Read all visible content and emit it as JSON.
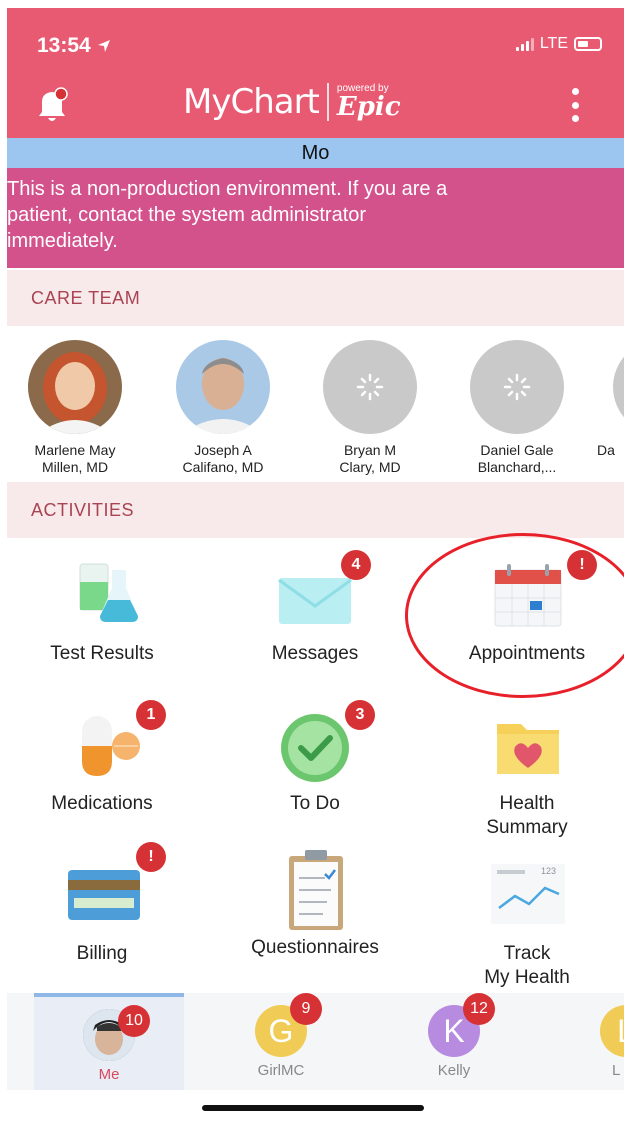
{
  "status_bar": {
    "time": "13:54",
    "network": "LTE"
  },
  "header": {
    "logo_text": "MyChart",
    "powered_by": "powered by",
    "epic": "Epic"
  },
  "patient_bar": {
    "name": "Mo"
  },
  "warning": {
    "lines": [
      "This is a non-production environment. If you are a",
      "patient, contact the system administrator",
      "immediately."
    ]
  },
  "care_team": {
    "title": "CARE TEAM",
    "members": [
      {
        "line1": "Marlene May",
        "line2": "Millen, MD"
      },
      {
        "line1": "Joseph A",
        "line2": "Califano, MD"
      },
      {
        "line1": "Bryan M",
        "line2": "Clary, MD"
      },
      {
        "line1": "Daniel Gale",
        "line2": "Blanchard,..."
      },
      {
        "line1": "Da",
        "line2": ""
      }
    ]
  },
  "activities": {
    "title": "ACTIVITIES",
    "items": [
      {
        "label": "Test Results",
        "icon": "test-tubes-icon",
        "badge": ""
      },
      {
        "label": "Messages",
        "icon": "envelope-icon",
        "badge": "4"
      },
      {
        "label": "Appointments",
        "icon": "calendar-icon",
        "badge": "!"
      },
      {
        "label": "Medications",
        "icon": "pills-icon",
        "badge": "1"
      },
      {
        "label": "To Do",
        "icon": "checkmark-clock-icon",
        "badge": "3"
      },
      {
        "label1": "Health",
        "label2": "Summary",
        "icon": "folder-heart-icon",
        "badge": ""
      },
      {
        "label": "Billing",
        "icon": "credit-card-icon",
        "badge": "!"
      },
      {
        "label": "Questionnaires",
        "icon": "clipboard-icon",
        "badge": ""
      },
      {
        "label1": "Track",
        "label2": "My Health",
        "icon": "trend-chart-icon",
        "badge": "",
        "chart_number": "123"
      }
    ]
  },
  "tabs": [
    {
      "label": "Me",
      "badge": "10",
      "initial": "",
      "color": "#5a6a80"
    },
    {
      "label": "GirlMC",
      "badge": "9",
      "initial": "G",
      "color": "#f0cc56"
    },
    {
      "label": "Kelly",
      "badge": "12",
      "initial": "K",
      "color": "#b78be0"
    },
    {
      "label": "L",
      "badge": "",
      "initial": "L",
      "color": "#f0cc56"
    }
  ],
  "colors": {
    "header": "#e85a72",
    "warning": "#d4528c",
    "patient_bar": "#9cc6f0",
    "badge": "#d63236",
    "section_text": "#a94452"
  }
}
